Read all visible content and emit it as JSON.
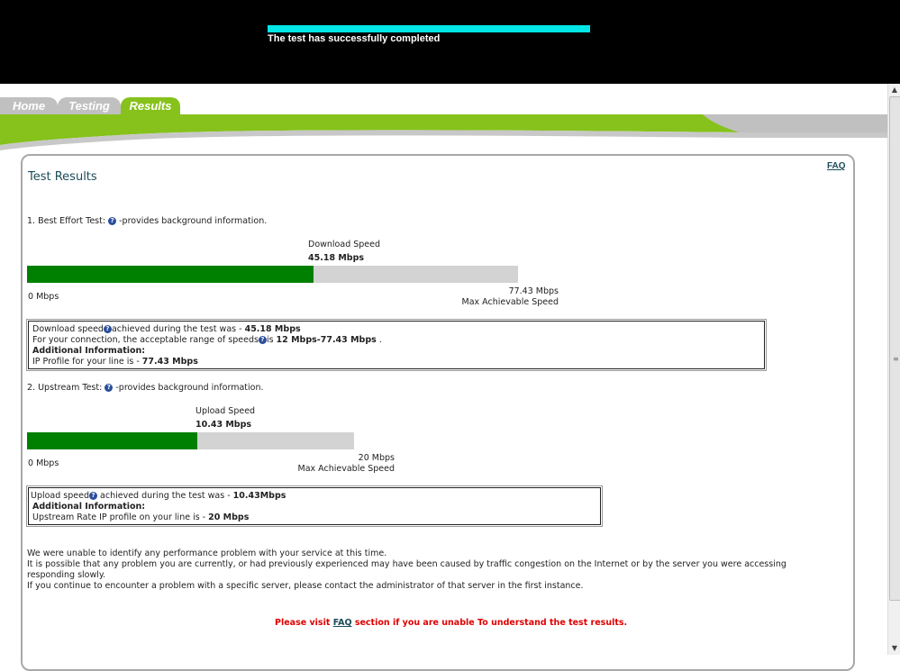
{
  "header": {
    "progress_fraction": 1.0,
    "status_text": "The test has successfully completed"
  },
  "tabs": [
    {
      "label": "Home"
    },
    {
      "label": "Testing"
    },
    {
      "label": "Results",
      "active": true
    }
  ],
  "colors": {
    "accent": "#86c21b",
    "progress": "#00e6e6",
    "bar_fill": "#008000",
    "bar_bg": "#d3d3d3",
    "warning": "#e00000"
  },
  "main": {
    "faq_link": "FAQ",
    "title": "Test Results",
    "best_effort": {
      "heading": "1. Best Effort Test:",
      "hint": "-provides background information.",
      "speed_label": "Download Speed",
      "speed_value": "45.18 Mbps",
      "value": 45.18,
      "max": 77.43,
      "min_label": "0 Mbps",
      "max_value_label": "77.43 Mbps",
      "max_label": "Max Achievable Speed",
      "info": {
        "line1_pre": "Download speed",
        "line1_mid": "achieved during the test was - ",
        "line1_val": "45.18 Mbps",
        "line2_pre": "For your connection, the acceptable range of speeds",
        "line2_mid": "is ",
        "line2_val": "12 Mbps-77.43 Mbps",
        "line2_post": " .",
        "additional": "Additional Information:",
        "line4_pre": "IP Profile for your line is - ",
        "line4_val": "77.43 Mbps"
      }
    },
    "upstream": {
      "heading": "2. Upstream Test:",
      "hint": "-provides background information.",
      "speed_label": "Upload Speed",
      "speed_value": "10.43 Mbps",
      "value": 10.43,
      "max": 20,
      "min_label": "0 Mbps",
      "max_value_label": "20 Mbps",
      "max_label": "Max Achievable Speed",
      "info": {
        "line1_pre": "Upload speed",
        "line1_mid": " achieved during the test was - ",
        "line1_val": "10.43Mbps",
        "additional": "Additional Information:",
        "line3_pre": "Upstream Rate IP profile on your line is - ",
        "line3_val": "20 Mbps"
      }
    },
    "notes": [
      "We were unable to identify any performance problem with your service at this time.",
      "It is possible that any problem you are currently, or had previously experienced may have been caused by traffic congestion on the Internet or by the server you were accessing",
      "responding slowly.",
      "If you continue to encounter a problem with a specific server, please contact the administrator of that server in the first instance."
    ],
    "visit": {
      "pre": "Please visit ",
      "link": "FAQ",
      "post": " section if you are unable To understand the test results."
    }
  }
}
